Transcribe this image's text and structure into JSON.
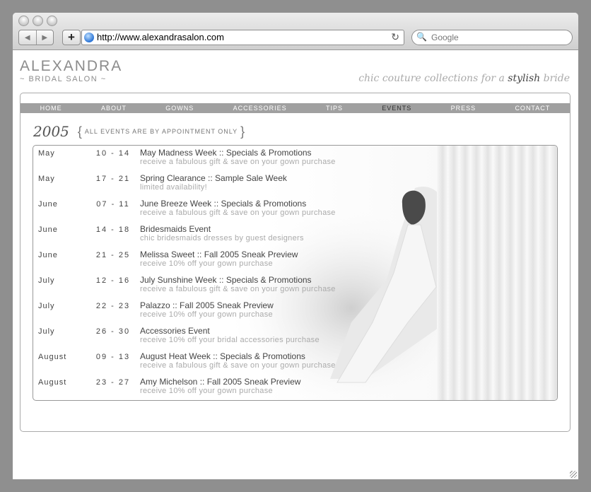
{
  "browser": {
    "back_label": "◀",
    "forward_label": "▶",
    "add_label": "+",
    "url": "http://www.alexandrasalon.com",
    "reload_label": "↻",
    "search_placeholder": "Google",
    "search_icon_label": "🔍"
  },
  "site": {
    "logo_name": "ALEXANDRA",
    "logo_sub": "~ BRIDAL SALON ~",
    "tagline_pre": "chic couture collections for a ",
    "tagline_em": "stylish",
    "tagline_post": " bride"
  },
  "nav": {
    "items": [
      "HOME",
      "ABOUT",
      "GOWNS",
      "ACCESSORIES",
      "TIPS",
      "EVENTS",
      "PRESS",
      "CONTACT"
    ],
    "active": "EVENTS"
  },
  "events": {
    "year": "2005",
    "brace_open": "{",
    "brace_close": "}",
    "note": "ALL EVENTS ARE BY APPOINTMENT ONLY",
    "rows": [
      {
        "month": "May",
        "dates": "10 - 14",
        "title": "May Madness Week :: Specials & Promotions",
        "desc": "receive a fabulous gift & save on your gown purchase"
      },
      {
        "month": "May",
        "dates": "17 - 21",
        "title": "Spring Clearance :: Sample Sale Week",
        "desc": "limited availability!"
      },
      {
        "month": "June",
        "dates": "07 - 11",
        "title": "June Breeze Week :: Specials & Promotions",
        "desc": "receive a fabulous gift & save on your gown purchase"
      },
      {
        "month": "June",
        "dates": "14 - 18",
        "title": "Bridesmaids Event",
        "desc": "chic bridesmaids dresses by guest designers"
      },
      {
        "month": "June",
        "dates": "21 - 25",
        "title": "Melissa Sweet :: Fall 2005 Sneak Preview",
        "desc": "receive 10% off your gown purchase"
      },
      {
        "month": "July",
        "dates": "12 - 16",
        "title": "July Sunshine Week :: Specials & Promotions",
        "desc": "receive a fabulous gift & save on your gown purchase"
      },
      {
        "month": "July",
        "dates": "22 - 23",
        "title": "Palazzo :: Fall 2005 Sneak Preview",
        "desc": "receive 10% off your gown purchase"
      },
      {
        "month": "July",
        "dates": "26 - 30",
        "title": "Accessories Event",
        "desc": "receive 10% off  your bridal accessories purchase"
      },
      {
        "month": "August",
        "dates": "09 - 13",
        "title": "August Heat Week :: Specials & Promotions",
        "desc": "receive a fabulous gift & save on your gown purchase"
      },
      {
        "month": "August",
        "dates": "23 - 27",
        "title": "Amy Michelson :: Fall 2005 Sneak Preview",
        "desc": "receive 10% off your gown purchase"
      }
    ]
  }
}
